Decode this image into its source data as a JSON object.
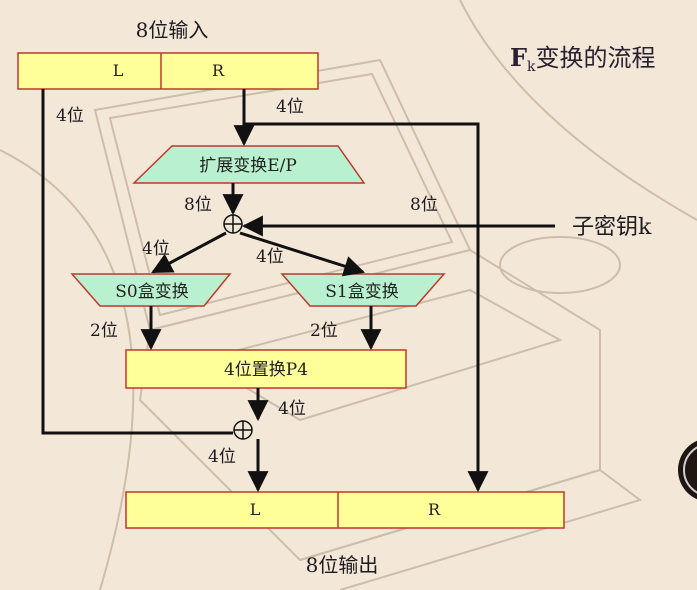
{
  "diagram": {
    "title_main": "F",
    "title_sub": "k",
    "title_rest": "变换的流程",
    "input_label": "8位输入",
    "output_label": "8位输出",
    "input_left": "L",
    "input_right": "R",
    "output_left": "L",
    "output_right": "R",
    "expand_label": "扩展变换E/P",
    "s0_label": "S0盒变换",
    "s1_label": "S1盒变换",
    "p4_label": "4位置换P4",
    "subkey_label": "子密钥k",
    "bits_4_left": "4位",
    "bits_4_right": "4位",
    "bits_8_expand": "8位",
    "bits_8_right": "8位",
    "bits_4_to_s0": "4位",
    "bits_4_to_s1": "4位",
    "bits_2_s0": "2位",
    "bits_2_s1": "2位",
    "bits_4_p4": "4位",
    "bits_4_xor": "4位"
  },
  "colors": {
    "box_fill": "#ffff99",
    "box_stroke": "#c0392b",
    "trap_fill": "#b9f0cf",
    "line": "#111111"
  }
}
